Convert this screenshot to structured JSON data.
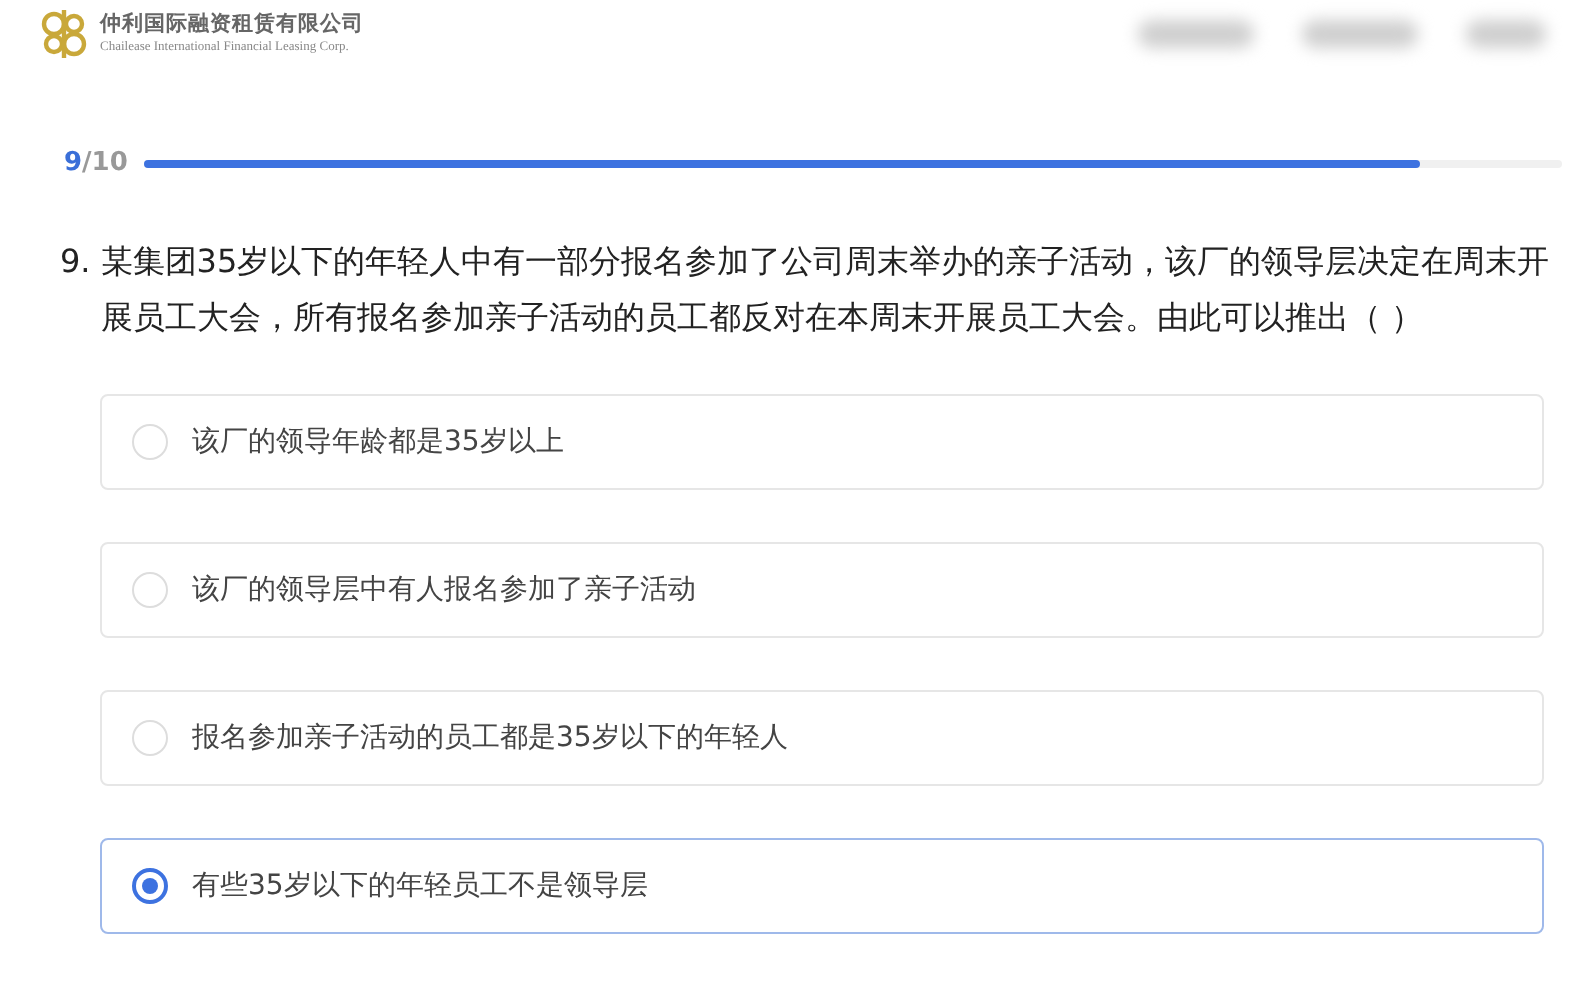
{
  "header": {
    "company_name": "仲利国际融资租赁有限公司",
    "company_name_en": "Chailease International Financial Leasing Corp."
  },
  "progress": {
    "current": "9",
    "total": "/10",
    "level": 0.9
  },
  "question": {
    "number": "9.",
    "text": "某集团35岁以下的年轻人中有一部分报名参加了公司周末举办的亲子活动，该厂的领导层决定在周末开展员工大会，所有报名参加亲子活动的员工都反对在本周末开展员工大会。由此可以推出（ ）"
  },
  "options": [
    {
      "label": "该厂的领导年龄都是35岁以上",
      "selected": false
    },
    {
      "label": "该厂的领导层中有人报名参加了亲子活动",
      "selected": false
    },
    {
      "label": "报名参加亲子活动的员工都是35岁以下的年轻人",
      "selected": false
    },
    {
      "label": "有些35岁以下的年轻员工不是领导层",
      "selected": true
    }
  ]
}
